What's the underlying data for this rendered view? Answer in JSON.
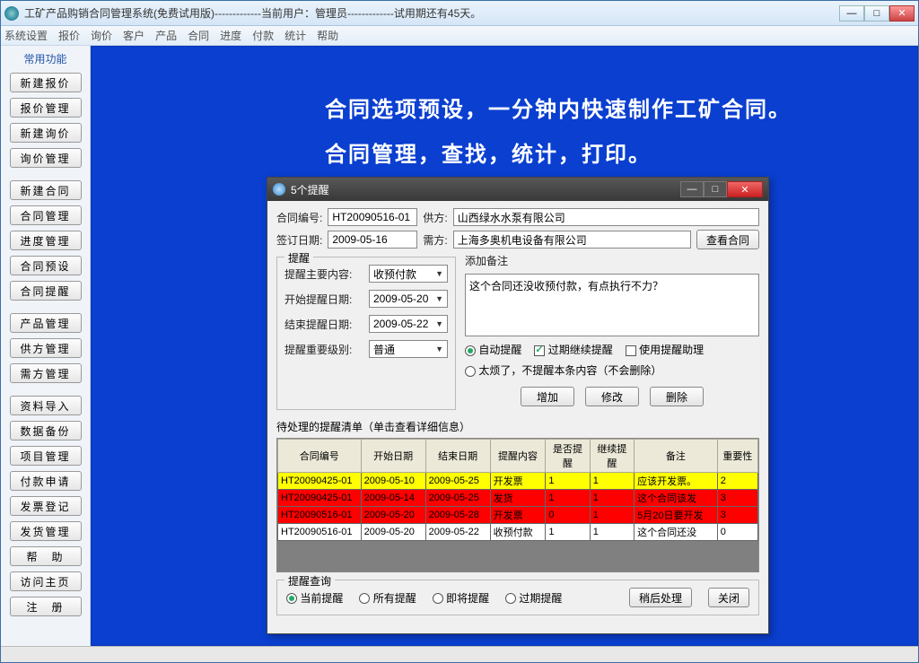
{
  "main": {
    "title": "工矿产品购销合同管理系统(免费试用版)-------------当前用户：管理员-------------试用期还有45天。"
  },
  "menubar": [
    "系统设置",
    "报价",
    "询价",
    "客户",
    "产品",
    "合同",
    "进度",
    "付款",
    "统计",
    "帮助"
  ],
  "sidebar": {
    "title": "常用功能",
    "items": [
      "新建报价",
      "报价管理",
      "新建询价",
      "询价管理",
      "新建合同",
      "合同管理",
      "进度管理",
      "合同预设",
      "合同提醒",
      "产品管理",
      "供方管理",
      "需方管理",
      "资料导入",
      "数据备份",
      "项目管理",
      "付款申请",
      "发票登记",
      "发货管理",
      "帮　助",
      "访问主页",
      "注　册"
    ]
  },
  "promo": {
    "line1": "合同选项预设，一分钟内快速制作工矿合同。",
    "line2": "合同管理，查找，统计，打印。"
  },
  "dialog": {
    "title": "5个提醒",
    "contract_no_label": "合同编号:",
    "contract_no": "HT20090516-01",
    "supplier_label": "供方:",
    "supplier": "山西绿水水泵有限公司",
    "sign_date_label": "签订日期:",
    "sign_date": "2009-05-16",
    "buyer_label": "需方:",
    "buyer": "上海多奥机电设备有限公司",
    "view_contract_btn": "查看合同",
    "remind_group": "提醒",
    "main_content_label": "提醒主要内容:",
    "main_content": "收预付款",
    "start_date_label": "开始提醒日期:",
    "start_date": "2009-05-20",
    "end_date_label": "结束提醒日期:",
    "end_date": "2009-05-22",
    "level_label": "提醒重要级别:",
    "level": "普通",
    "note_label": "添加备注",
    "note_text": "这个合同还没收预付款，有点执行不力？",
    "auto_remind": "自动提醒",
    "continue_remind": "过期继续提醒",
    "use_assistant": "使用提醒助理",
    "tired_option": "太烦了，不提醒本条内容（不会删除）",
    "add_btn": "增加",
    "edit_btn": "修改",
    "delete_btn": "删除",
    "list_caption": "待处理的提醒清单（单击查看详细信息）",
    "columns": [
      "合同编号",
      "开始日期",
      "结束日期",
      "提醒内容",
      "是否提醒",
      "继续提醒",
      "备注",
      "重要性"
    ],
    "rows": [
      {
        "style": "yellow",
        "cells": [
          "HT20090425-01",
          "2009-05-10",
          "2009-05-25",
          "开发票",
          "1",
          "1",
          "应该开发票。",
          "2"
        ]
      },
      {
        "style": "red",
        "cells": [
          "HT20090425-01",
          "2009-05-14",
          "2009-05-25",
          "发货",
          "1",
          "1",
          "这个合同该发",
          "3"
        ]
      },
      {
        "style": "red",
        "cells": [
          "HT20090516-01",
          "2009-05-20",
          "2009-05-28",
          "开发票",
          "0",
          "1",
          "5月20日要开发",
          "3"
        ]
      },
      {
        "style": "white",
        "cells": [
          "HT20090516-01",
          "2009-05-20",
          "2009-05-22",
          "收预付款",
          "1",
          "1",
          "这个合同还没",
          "0"
        ]
      }
    ],
    "query_group": "提醒查询",
    "q_current": "当前提醒",
    "q_all": "所有提醒",
    "q_coming": "即将提醒",
    "q_overdue": "过期提醒",
    "later_btn": "稍后处理",
    "close_btn": "关闭"
  }
}
